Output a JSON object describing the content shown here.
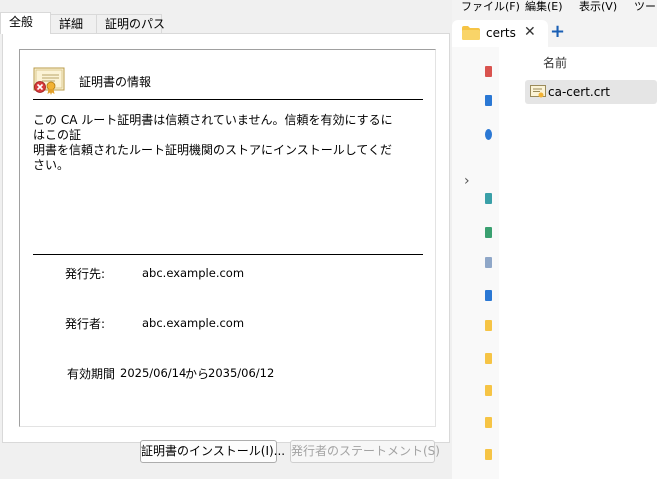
{
  "dialog": {
    "tabs": [
      {
        "label": "全般"
      },
      {
        "label": "詳細"
      },
      {
        "label": "証明のパス"
      }
    ],
    "info_title": "証明書の情報",
    "message": "この CA ルート証明書は信頼されていません。信頼を有効にするにはこの証\n明書を信頼されたルート証明機関のストアにインストールしてください。",
    "issued_to_label": "発行先:",
    "issued_to_value": "abc.example.com",
    "issued_by_label": "発行者:",
    "issued_by_value": "abc.example.com",
    "validity_label": "有効期間",
    "valid_from": "2025/06/14",
    "valid_word": "から",
    "valid_to": "2035/06/12",
    "install_button": "証明書のインストール(I)...",
    "statement_button": "発行者のステートメント(S)"
  },
  "explorer": {
    "menu": [
      "ファイル(F)",
      "編集(E)",
      "表示(V)",
      "ツー"
    ],
    "tab_title": "certs",
    "tab_close": "✕",
    "new_tab": "+",
    "nav_chevron": "›",
    "column_header": "名前",
    "file_name": "ca-cert.crt"
  },
  "colors": {
    "accent": "#1a5fb4",
    "folder": "#f6c445",
    "error": "#d83b3b"
  }
}
